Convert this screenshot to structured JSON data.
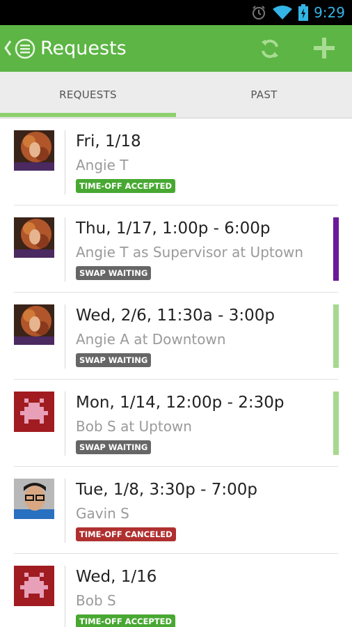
{
  "status_bar": {
    "time": "9:29",
    "icons": [
      "alarm-icon",
      "wifi-icon",
      "battery-charging-icon"
    ]
  },
  "action_bar": {
    "title": "Requests",
    "color": "#5cb544",
    "icons": [
      "up-caret-icon",
      "app-menu-icon",
      "refresh-icon",
      "add-icon"
    ]
  },
  "tabs": [
    {
      "label": "REQUESTS",
      "selected": true
    },
    {
      "label": "PAST",
      "selected": false
    }
  ],
  "requests": [
    {
      "when": "Fri, 1/18",
      "who": "Angie T",
      "status": "TIME-OFF ACCEPTED",
      "status_color": "#48a832",
      "avatar": "curly-hair-photo",
      "accent_color": ""
    },
    {
      "when": "Thu, 1/17, 1:00p - 6:00p",
      "who": "Angie T as Supervisor at Uptown",
      "status": "SWAP WAITING",
      "status_color": "#666666",
      "avatar": "curly-hair-photo",
      "accent_color": "#6a1a9a"
    },
    {
      "when": "Wed, 2/6, 11:30a - 3:00p",
      "who": "Angie A at Downtown",
      "status": "SWAP WAITING",
      "status_color": "#666666",
      "avatar": "curly-hair-photo",
      "accent_color": "#a6d88e"
    },
    {
      "when": "Mon, 1/14, 12:00p - 2:30p",
      "who": "Bob S at Uptown",
      "status": "SWAP WAITING",
      "status_color": "#666666",
      "avatar": "pixel-invader-avatar",
      "accent_color": "#a6d88e"
    },
    {
      "when": "Tue, 1/8, 3:30p - 7:00p",
      "who": "Gavin S",
      "status": "TIME-OFF CANCELED",
      "status_color": "#b03030",
      "avatar": "glasses-man-photo",
      "accent_color": ""
    },
    {
      "when": "Wed, 1/16",
      "who": "Bob S",
      "status": "TIME-OFF ACCEPTED",
      "status_color": "#48a832",
      "avatar": "pixel-invader-avatar",
      "accent_color": ""
    }
  ]
}
